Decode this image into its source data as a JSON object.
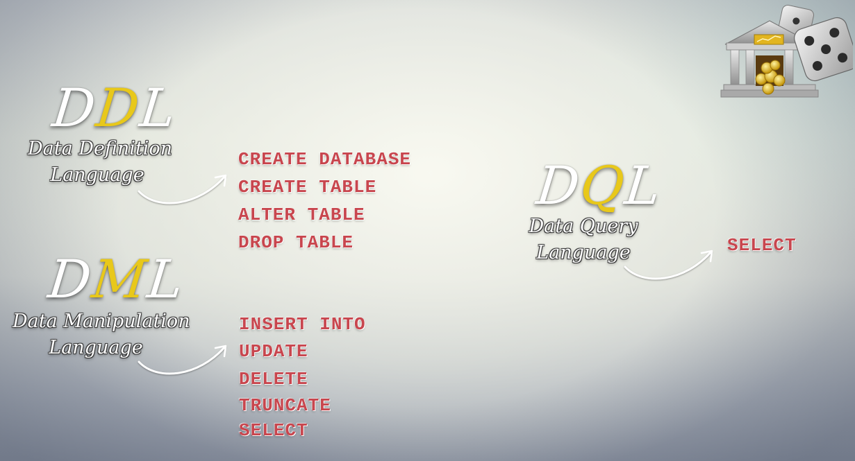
{
  "ddl": {
    "acronym_prefix": "D",
    "acronym_highlight": "D",
    "acronym_suffix": "L",
    "subtitle_line1": "Data Definition",
    "subtitle_line2": "Language",
    "commands": [
      "CREATE DATABASE",
      "CREATE TABLE",
      "ALTER TABLE",
      "DROP TABLE"
    ]
  },
  "dml": {
    "acronym_prefix": "D",
    "acronym_highlight": "M",
    "acronym_suffix": "L",
    "subtitle_line1": "Data Manipulation",
    "subtitle_line2": "Language",
    "commands": [
      "INSERT INTO",
      "UPDATE",
      "DELETE",
      "TRUNCATE",
      "SELECT"
    ]
  },
  "dql": {
    "acronym_prefix": "D",
    "acronym_highlight": "Q",
    "acronym_suffix": "L",
    "subtitle_line1": "Data Query",
    "subtitle_line2": "Language",
    "commands": [
      "SELECT"
    ]
  },
  "colors": {
    "command_text": "#c8464e",
    "acronym_highlight": "#e8c81a",
    "acronym_text": "#ffffff"
  },
  "icons": {
    "logo": "bank-and-dice-icon",
    "arrow": "curved-arrow-icon"
  }
}
